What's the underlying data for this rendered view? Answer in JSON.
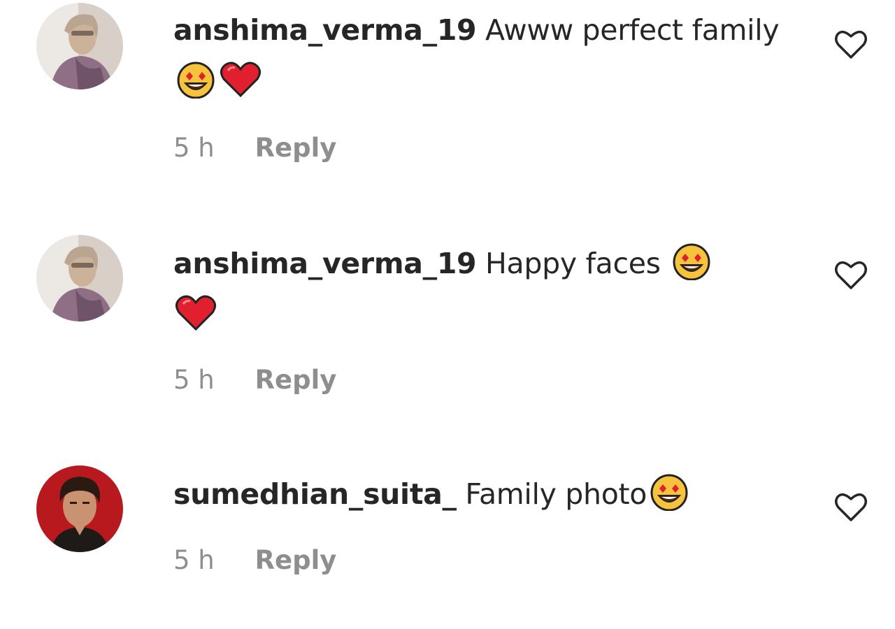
{
  "comments": [
    {
      "username": "anshima_verma_19",
      "text": "Awww perfect family",
      "emojis": [
        "heart-eyes-emoji",
        "red-heart-emoji"
      ],
      "time": "5 h",
      "reply_label": "Reply"
    },
    {
      "username": "anshima_verma_19",
      "text": "Happy faces",
      "emojis": [
        "heart-eyes-emoji",
        "red-heart-emoji"
      ],
      "time": "5 h",
      "reply_label": "Reply"
    },
    {
      "username": "sumedhian_suita_",
      "text": "Family photo",
      "emojis": [
        "heart-eyes-emoji"
      ],
      "time": "5 h",
      "reply_label": "Reply"
    }
  ],
  "icons": {
    "like": "heart-outline-icon"
  },
  "colors": {
    "text": "#262626",
    "meta": "#8e8e8e",
    "background": "#ffffff",
    "heart": "#e0202f",
    "emoji_face": "#f7c23c"
  }
}
